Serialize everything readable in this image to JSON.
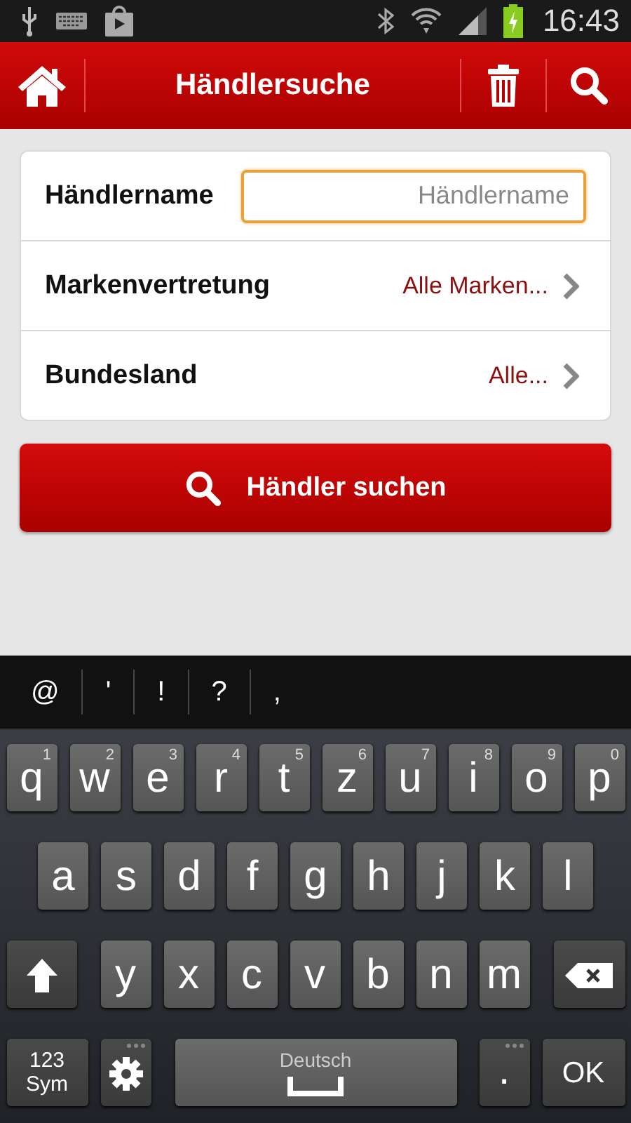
{
  "status_bar": {
    "time": "16:43"
  },
  "app_bar": {
    "title": "Händlersuche"
  },
  "form": {
    "rows": [
      {
        "kind": "input",
        "label": "Händlername",
        "placeholder": "Händlername",
        "focused": true
      },
      {
        "kind": "select",
        "label": "Markenvertretung",
        "value": "Alle Marken..."
      },
      {
        "kind": "select",
        "label": "Bundesland",
        "value": "Alle..."
      }
    ]
  },
  "search_button": {
    "label": "Händler suchen"
  },
  "suggestions": [
    "@",
    "'",
    "!",
    "?",
    ","
  ],
  "keyboard": {
    "rows": [
      {
        "keys": [
          {
            "kind": "char",
            "label": "q",
            "hint": "1"
          },
          {
            "kind": "char",
            "label": "w",
            "hint": "2"
          },
          {
            "kind": "char",
            "label": "e",
            "hint": "3"
          },
          {
            "kind": "char",
            "label": "r",
            "hint": "4"
          },
          {
            "kind": "char",
            "label": "t",
            "hint": "5"
          },
          {
            "kind": "char",
            "label": "z",
            "hint": "6"
          },
          {
            "kind": "char",
            "label": "u",
            "hint": "7"
          },
          {
            "kind": "char",
            "label": "i",
            "hint": "8"
          },
          {
            "kind": "char",
            "label": "o",
            "hint": "9"
          },
          {
            "kind": "char",
            "label": "p",
            "hint": "0"
          }
        ]
      },
      {
        "keys": [
          {
            "kind": "char",
            "label": "a"
          },
          {
            "kind": "char",
            "label": "s"
          },
          {
            "kind": "char",
            "label": "d"
          },
          {
            "kind": "char",
            "label": "f"
          },
          {
            "kind": "char",
            "label": "g"
          },
          {
            "kind": "char",
            "label": "h"
          },
          {
            "kind": "char",
            "label": "j"
          },
          {
            "kind": "char",
            "label": "k"
          },
          {
            "kind": "char",
            "label": "l"
          }
        ]
      },
      {
        "keys": [
          {
            "kind": "shift"
          },
          {
            "kind": "char",
            "label": "y"
          },
          {
            "kind": "char",
            "label": "x"
          },
          {
            "kind": "char",
            "label": "c"
          },
          {
            "kind": "char",
            "label": "v"
          },
          {
            "kind": "char",
            "label": "b"
          },
          {
            "kind": "char",
            "label": "n"
          },
          {
            "kind": "char",
            "label": "m"
          },
          {
            "kind": "backspace"
          }
        ]
      },
      {
        "keys": [
          {
            "kind": "sym",
            "label": "123 Sym"
          },
          {
            "kind": "settings"
          },
          {
            "kind": "space",
            "label": "Deutsch"
          },
          {
            "kind": "period",
            "label": "."
          },
          {
            "kind": "ok",
            "label": "OK"
          }
        ]
      }
    ]
  }
}
